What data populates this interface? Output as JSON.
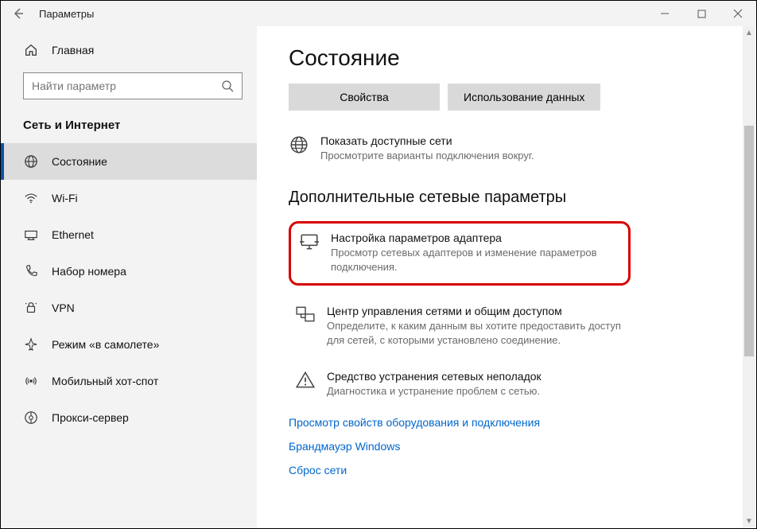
{
  "window": {
    "title": "Параметры"
  },
  "sidebar": {
    "home": "Главная",
    "search_placeholder": "Найти параметр",
    "category": "Сеть и Интернет",
    "items": [
      {
        "label": "Состояние"
      },
      {
        "label": "Wi-Fi"
      },
      {
        "label": "Ethernet"
      },
      {
        "label": "Набор номера"
      },
      {
        "label": "VPN"
      },
      {
        "label": "Режим «в самолете»"
      },
      {
        "label": "Мобильный хот-спот"
      },
      {
        "label": "Прокси-сервер"
      }
    ]
  },
  "main": {
    "title": "Состояние",
    "buttons": {
      "properties": "Свойства",
      "data_usage": "Использование данных"
    },
    "available": {
      "title": "Показать доступные сети",
      "desc": "Просмотрите варианты подключения вокруг."
    },
    "section_title": "Дополнительные сетевые параметры",
    "rows": [
      {
        "title": "Настройка параметров адаптера",
        "desc": "Просмотр сетевых адаптеров и изменение параметров подключения."
      },
      {
        "title": "Центр управления сетями и общим доступом",
        "desc": "Определите, к каким данным вы хотите предоставить доступ для сетей, с которыми установлено соединение."
      },
      {
        "title": "Средство устранения сетевых неполадок",
        "desc": "Диагностика и устранение проблем с сетью."
      }
    ],
    "links": [
      "Просмотр свойств оборудования и подключения",
      "Брандмауэр Windows",
      "Сброс сети"
    ]
  }
}
